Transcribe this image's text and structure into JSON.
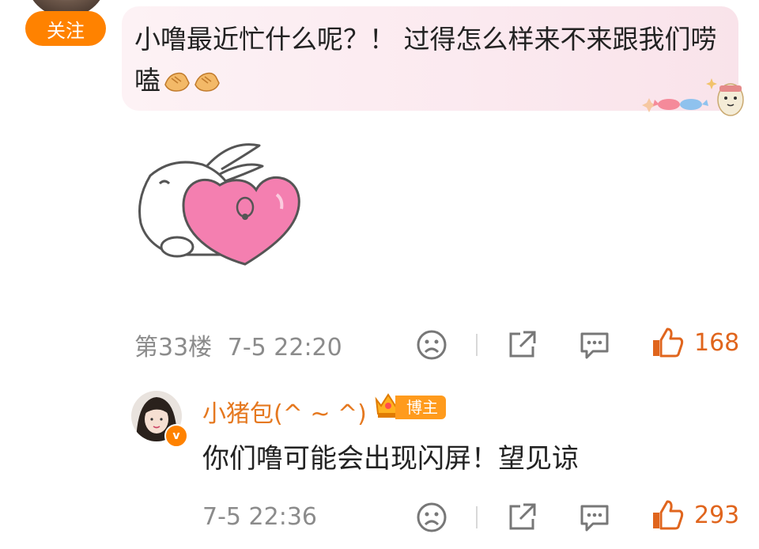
{
  "top_comment": {
    "follow_label": "关注",
    "text": "小噜最近忙什么呢？！ 过得怎么样来不来跟我们唠嗑",
    "floor": "第33楼",
    "time": "7-5 22:20",
    "likes": "168"
  },
  "reply": {
    "username": "小猪包(^ ~ ^)",
    "badge_label": "博主",
    "text": "你们噜可能会出现闪屏！望见谅",
    "time": "7-5 22:36",
    "likes": "293"
  },
  "icons": {
    "dislike": "sad-face-icon",
    "share": "share-icon",
    "comment": "comment-icon",
    "like": "thumbs-up-icon",
    "clap": "clapping-hands-icon"
  },
  "colors": {
    "accent": "#ff8200",
    "like": "#e0651d",
    "username": "#e5781f",
    "meta": "#8b8b8b",
    "bubble": "#fbe9ef"
  }
}
